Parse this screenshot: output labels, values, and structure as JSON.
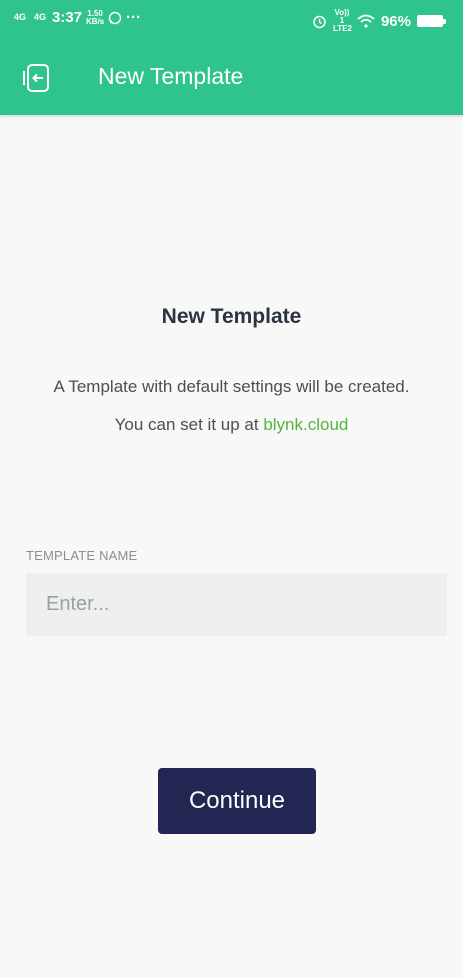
{
  "status_bar": {
    "network1": "4G",
    "network2": "4G",
    "time": "3:37",
    "speed_value": "1.50",
    "speed_unit": "KB/s",
    "more": "···",
    "volte": "Vo)) 1",
    "lte": "LTE2",
    "battery_percent": "96%"
  },
  "app_bar": {
    "title": "New Template"
  },
  "main": {
    "heading": "New Template",
    "description_prefix": "A Template with default settings will be created. You can set it up at ",
    "description_link": "blynk.cloud",
    "field_label": "TEMPLATE NAME",
    "field_placeholder": "Enter...",
    "field_value": "",
    "continue_label": "Continue"
  },
  "colors": {
    "accent": "#2fc48b",
    "button": "#232653",
    "link": "#52b53c"
  }
}
